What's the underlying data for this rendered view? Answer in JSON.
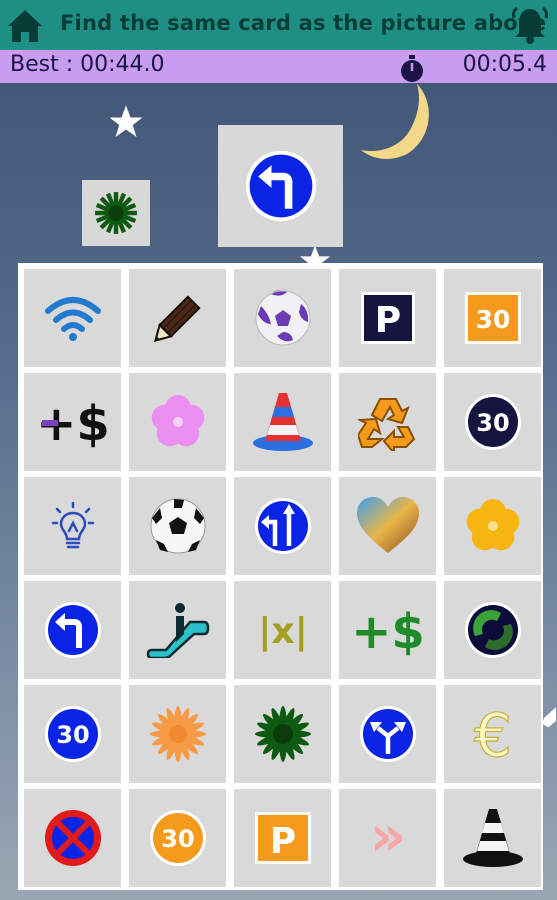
{
  "header": {
    "title": "Find the same card as the picture above",
    "home_icon": "home-icon",
    "bell_icon": "bell-icon"
  },
  "stats": {
    "best": "Best : 00:44.0",
    "timer": "00:05.4"
  },
  "target": {
    "small_card_icon": "green-flower-burst-icon",
    "large_card_icon": "blue-turn-left-sign-icon"
  },
  "colors": {
    "header_bg": "#1e8f83",
    "stat_bg": "#c89cef",
    "card_bg": "#d9d9d9",
    "sign_blue": "#0a24e6"
  },
  "cards": [
    {
      "icon": "wifi-icon"
    },
    {
      "icon": "pencil-icon"
    },
    {
      "icon": "purple-ball-icon"
    },
    {
      "icon": "parking-sign-dark-icon",
      "text": "P"
    },
    {
      "icon": "orange-30-square-icon",
      "text": "30"
    },
    {
      "icon": "plus-dollar-icon",
      "text": "+$"
    },
    {
      "icon": "pink-flower-icon"
    },
    {
      "icon": "traffic-cone-blue-icon"
    },
    {
      "icon": "recycle-icon"
    },
    {
      "icon": "dark-30-circle-icon",
      "text": "30"
    },
    {
      "icon": "lightbulb-icon"
    },
    {
      "icon": "soccer-ball-icon"
    },
    {
      "icon": "blue-arrow-sign-icon"
    },
    {
      "icon": "gradient-heart-icon"
    },
    {
      "icon": "yellow-flower-icon"
    },
    {
      "icon": "blue-turn-left-sign-icon"
    },
    {
      "icon": "escalator-icon"
    },
    {
      "icon": "olive-x-icon",
      "text": "|x|"
    },
    {
      "icon": "green-plus-dollar-icon",
      "text": "+$"
    },
    {
      "icon": "green-dot-icon"
    },
    {
      "icon": "blue-30-circle-icon",
      "text": "30"
    },
    {
      "icon": "orange-burst-icon"
    },
    {
      "icon": "green-flower-burst-icon"
    },
    {
      "icon": "blue-split-arrow-sign-icon"
    },
    {
      "icon": "euro-icon",
      "text": "€"
    },
    {
      "icon": "no-stopping-sign-icon"
    },
    {
      "icon": "orange-30-circle-icon",
      "text": "30"
    },
    {
      "icon": "parking-sign-orange-icon",
      "text": "P"
    },
    {
      "icon": "pink-chevrons-icon",
      "text": "»"
    },
    {
      "icon": "traffic-cone-black-icon"
    }
  ]
}
